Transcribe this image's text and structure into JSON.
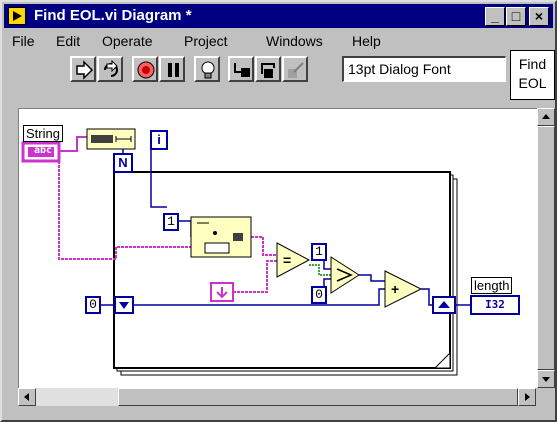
{
  "window": {
    "title": "Find EOL.vi Diagram *"
  },
  "title_buttons": {
    "minimize": "_",
    "maximize": "□",
    "close": "×"
  },
  "menu": [
    {
      "label": "File"
    },
    {
      "label": "Edit"
    },
    {
      "label": "Operate"
    },
    {
      "label": "Project"
    },
    {
      "label": "Windows"
    },
    {
      "label": "Help"
    }
  ],
  "toolbar": {
    "tools": [
      "run-arrow-icon",
      "run-continuously-icon",
      "abort-icon",
      "pause-icon",
      "highlight-execution-icon",
      "step-into-icon",
      "step-over-icon",
      "step-out-icon"
    ],
    "font_value": "13pt Dialog Font"
  },
  "context_help": {
    "line1": "Find",
    "line2": "EOL"
  },
  "diagram": {
    "string_label": "String",
    "string_terminal": "abc",
    "count_terminal": "N",
    "iteration_terminal": "i",
    "const_one_a": "1",
    "const_one_b": "1",
    "const_zero_a": "0",
    "const_zero_b": "0",
    "length_label": "length",
    "length_terminal": "I32",
    "equal_symbol": "=",
    "add_symbol": "+"
  },
  "colors": {
    "title_bg": "#000080",
    "wire_string": "#cc33cc",
    "wire_int": "#0000a0",
    "function_fill": "#ffffc0"
  }
}
